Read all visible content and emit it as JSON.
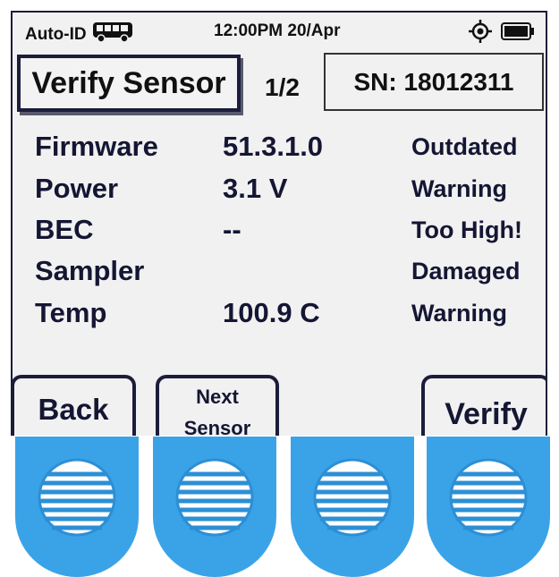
{
  "status_bar": {
    "mode": "Auto-ID",
    "mode_icon": "bus-icon",
    "datetime": "12:00PM 20/Apr",
    "gps_icon": "crosshair-icon",
    "battery_icon": "battery-icon"
  },
  "header": {
    "title": "Verify Sensor",
    "page": "1/2",
    "serial": "SN: 18012311"
  },
  "rows": [
    {
      "label": "Firmware",
      "value": "51.3.1.0",
      "status": "Outdated"
    },
    {
      "label": "Power",
      "value": "3.1 V",
      "status": "Warning"
    },
    {
      "label": "BEC",
      "value": "--",
      "status": "Too High!"
    },
    {
      "label": "Sampler",
      "value": "",
      "status": "Damaged"
    },
    {
      "label": "Temp",
      "value": "100.9 C",
      "status": "Warning"
    }
  ],
  "softkeys": {
    "back": "Back",
    "next_line1": "Next",
    "next_line2": "Sensor",
    "verify": "Verify"
  },
  "colors": {
    "frame": "#1b1d3a",
    "screen_bg": "#f1f1f1",
    "text": "#141633",
    "hw_button": "#3aa3e8"
  }
}
